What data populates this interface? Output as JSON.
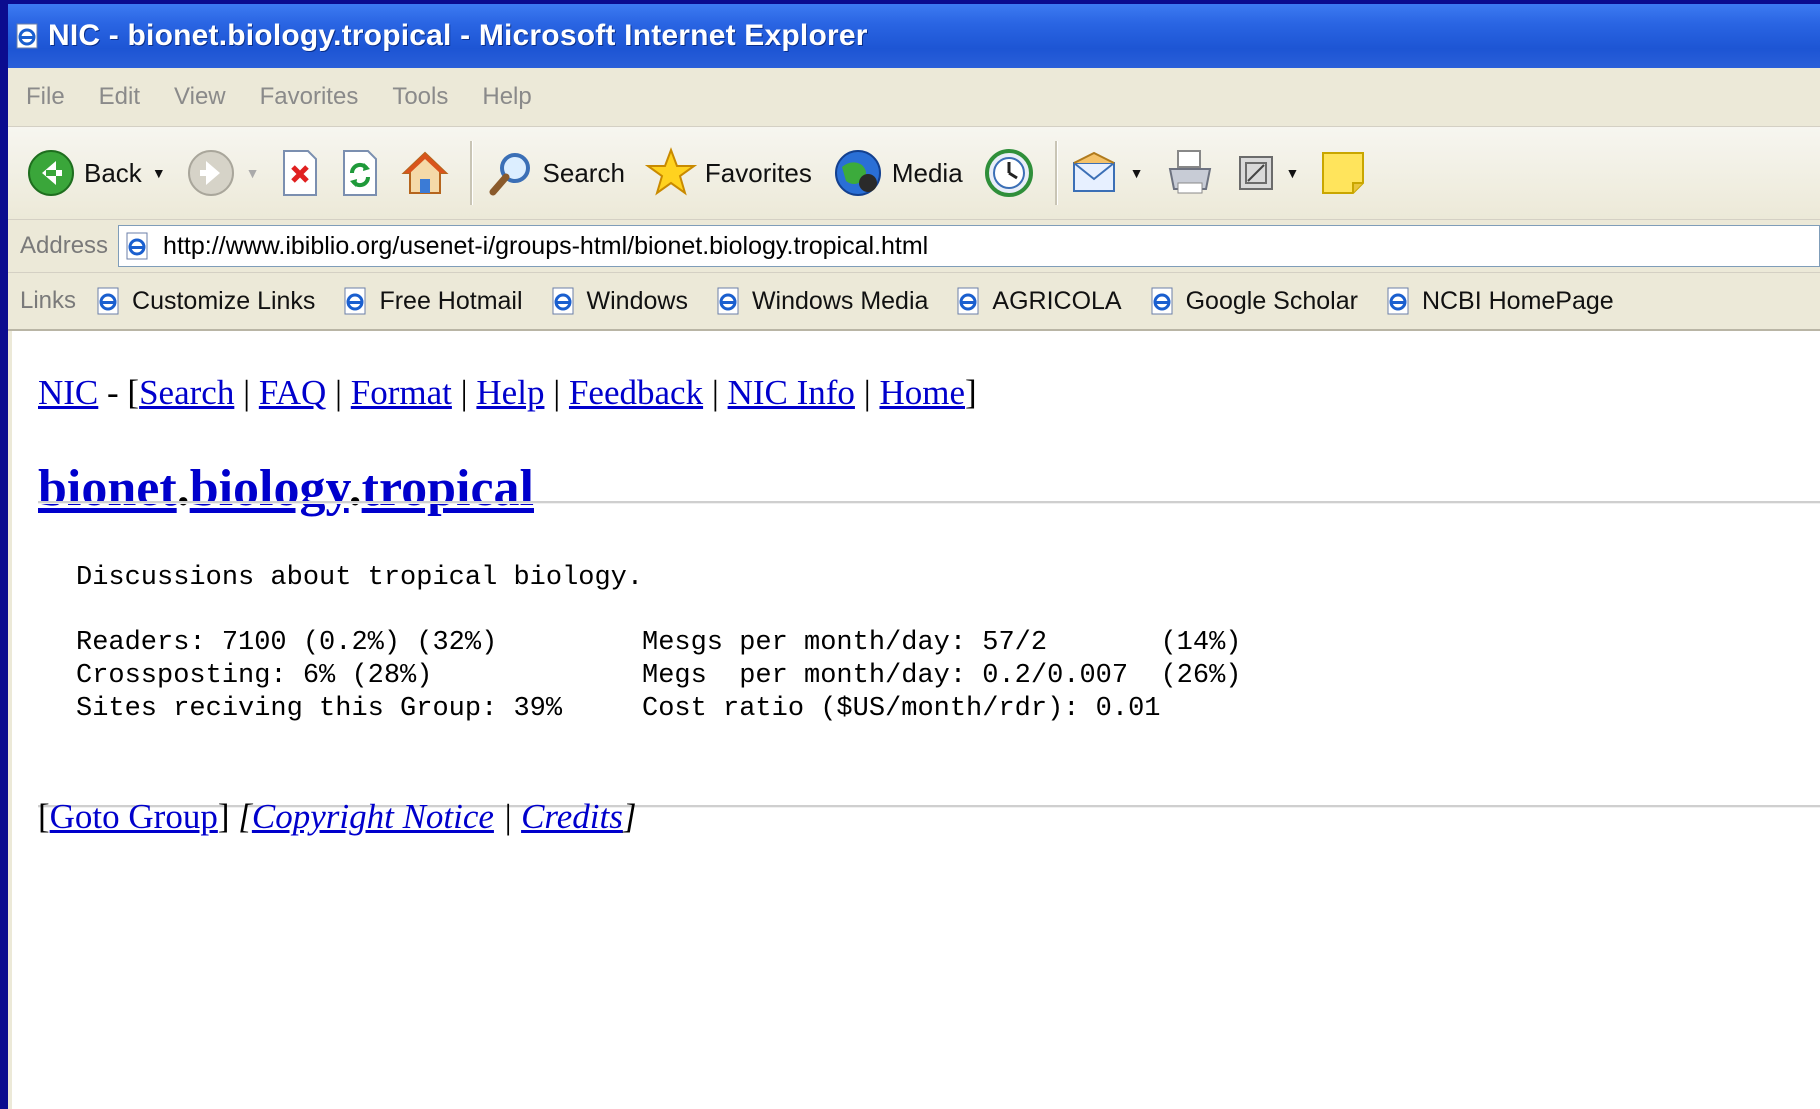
{
  "window": {
    "title": "NIC - bionet.biology.tropical - Microsoft Internet Explorer"
  },
  "menu": [
    "File",
    "Edit",
    "View",
    "Favorites",
    "Tools",
    "Help"
  ],
  "toolbar": {
    "back_label": "Back",
    "search_label": "Search",
    "favorites_label": "Favorites",
    "media_label": "Media"
  },
  "address": {
    "label": "Address",
    "url": "http://www.ibiblio.org/usenet-i/groups-html/bionet.biology.tropical.html"
  },
  "links": {
    "label": "Links",
    "items": [
      "Customize Links",
      "Free Hotmail",
      "Windows",
      "Windows Media",
      "AGRICOLA",
      "Google Scholar",
      "NCBI HomePage"
    ]
  },
  "page": {
    "nav": {
      "nic": "NIC",
      "dash": " - [",
      "items": [
        "Search",
        "FAQ",
        "Format",
        "Help",
        "Feedback",
        "NIC Info",
        "Home"
      ],
      "close": "]"
    },
    "group_parts": [
      "bionet",
      "biology",
      "tropical"
    ],
    "description": "Discussions about tropical biology.",
    "stats_left": [
      "Readers: 7100 (0.2%) (32%)",
      "Crossposting: 6% (28%)",
      "Sites reciving this Group: 39%"
    ],
    "stats_right": [
      "Mesgs per month/day: 57/2       (14%)",
      "Megs  per month/day: 0.2/0.007  (26%)",
      "Cost ratio ($US/month/rdr): 0.01"
    ],
    "footer": {
      "goto": "Goto Group",
      "copyright": "Copyright Notice",
      "credits": "Credits"
    }
  }
}
